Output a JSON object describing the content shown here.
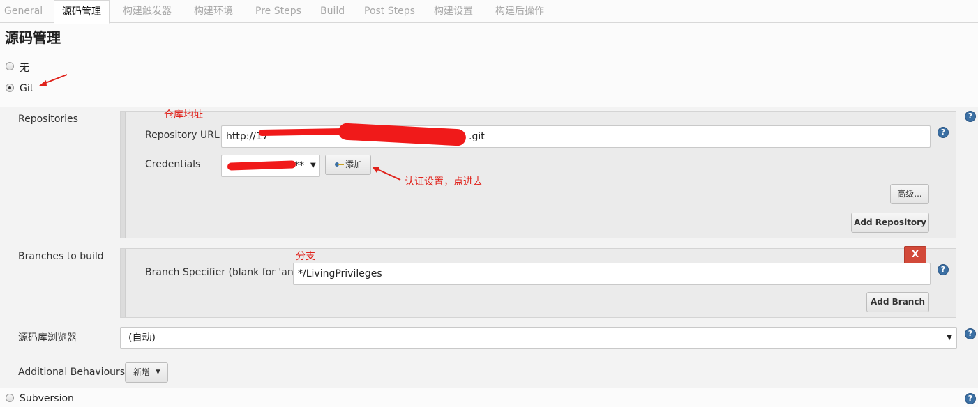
{
  "tabs": [
    {
      "label": "General",
      "active": false
    },
    {
      "label": "源码管理",
      "active": true
    },
    {
      "label": "构建触发器",
      "active": false
    },
    {
      "label": "构建环境",
      "active": false
    },
    {
      "label": "Pre Steps",
      "active": false
    },
    {
      "label": "Build",
      "active": false
    },
    {
      "label": "Post Steps",
      "active": false
    },
    {
      "label": "构建设置",
      "active": false
    },
    {
      "label": "构建后操作",
      "active": false
    }
  ],
  "page_title": "源码管理",
  "scm_options": {
    "none_label": "无",
    "git_label": "Git",
    "svn_label": "Subversion",
    "selected": "Git"
  },
  "repositories": {
    "label": "Repositories",
    "url_label": "Repository URL",
    "url_prefix": "http://17",
    "url_suffix": ".git",
    "credentials_label": "Credentials",
    "credentials_value_suffix": "**",
    "add_button_label": "添加",
    "advanced_button_label": "高级...",
    "add_repository_button_label": "Add Repository"
  },
  "branches": {
    "label": "Branches to build",
    "specifier_label": "Branch Specifier (blank for 'any')",
    "specifier_value": "*/LivingPrivileges",
    "delete_button_label": "X",
    "add_branch_button_label": "Add Branch"
  },
  "browser": {
    "label": "源码库浏览器",
    "selected": "(自动)"
  },
  "additional_behaviours": {
    "label": "Additional Behaviours",
    "add_button_label": "新增"
  },
  "annotations": {
    "repo_address": "仓库地址",
    "auth_setting": "认证设置，点进去",
    "branch": "分支"
  },
  "help_symbol": "?",
  "colors": {
    "annotation_red": "#e0221b",
    "delete_button_red": "#d24939",
    "help_blue": "#3b6fa3"
  }
}
